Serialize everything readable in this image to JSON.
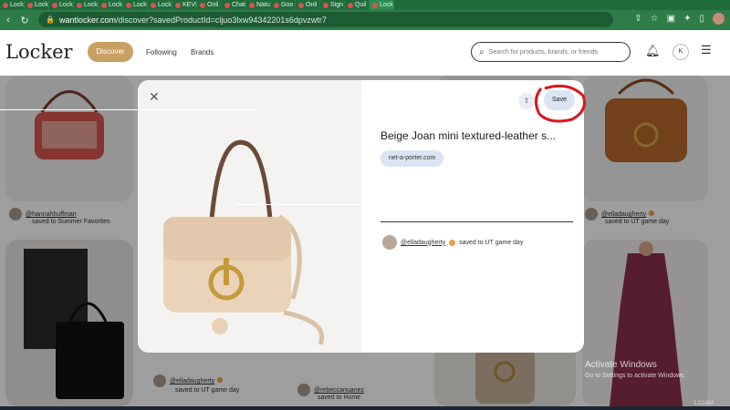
{
  "browser": {
    "tabs": [
      "Lock",
      "Lock",
      "Lock",
      "Lock",
      "Lock",
      "Lock",
      "Lock",
      "KEVI",
      "Onli",
      "Chat",
      "Natu",
      "Goo",
      "Onli",
      "Sign",
      "Quil",
      "Lock"
    ],
    "url_host": "wantlocker.com",
    "url_path": "/discover?savedProductId=cljuo3lxw94342201s6dpvzwtr7"
  },
  "header": {
    "logo": "Locker",
    "nav": {
      "discover": "Discover",
      "following": "Following",
      "brands": "Brands"
    },
    "search_placeholder": "Search for products, brands, or friends",
    "avatar_initial": "K"
  },
  "feed": {
    "cards": [
      {
        "user": "@hannahhuffman",
        "saved_to": "saved to Summer Favorites"
      },
      {
        "user": "@elladaugherty",
        "saved_to": "saved to UT game day"
      },
      {
        "user": "@elladaugherty",
        "saved_to": "saved to UT game day"
      },
      {
        "user": "@rebeccanuanez",
        "saved_to": "saved to Home"
      }
    ]
  },
  "modal": {
    "title": "Beige Joan mini textured-leather s...",
    "retailer": "net-a-porter.com",
    "save_label": "Save",
    "saved_by": {
      "user": "@elladaugherty",
      "saved_to": "saved to UT game day"
    }
  },
  "watermark": {
    "title": "Activate Windows",
    "subtitle": "Go to Settings to activate Windows."
  },
  "taskbar": {
    "time": "1:22 AM"
  },
  "colors": {
    "tab_bar": "#1f6b3a",
    "address_bar": "#2e7d46",
    "discover_pill": "#c9a063",
    "save_button": "#dbe4f2",
    "annotation_red": "#e0141a"
  },
  "icons": [
    "back-icon",
    "forward-icon",
    "reload-icon",
    "lock-icon",
    "search-icon",
    "bell-icon",
    "menu-icon",
    "close-icon",
    "share-icon",
    "star-icon",
    "extension-icon"
  ]
}
